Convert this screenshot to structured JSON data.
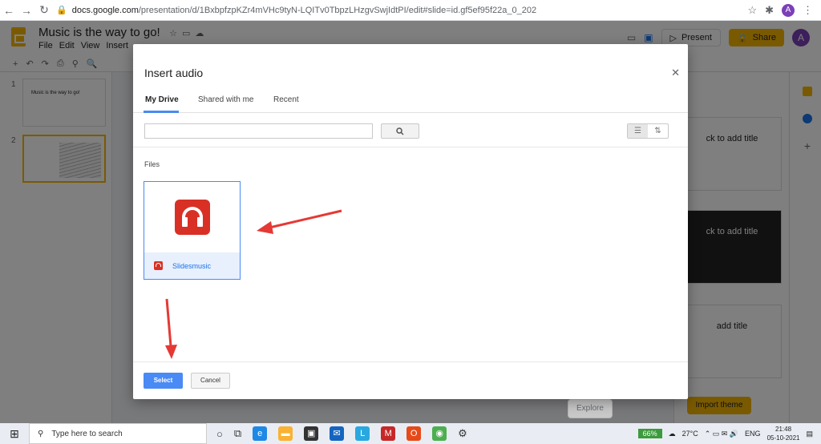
{
  "browser": {
    "url_host": "docs.google.com",
    "url_path": "/presentation/d/1BxbpfzpKZr4mVHc9tyN-LQITv0TbpzLHzgvSwjIdtPI/edit#slide=id.gf5ef95f22a_0_202",
    "profile_initial": "A"
  },
  "app": {
    "doc_title": "Music is the way to go!",
    "menus": [
      "File",
      "Edit",
      "View",
      "Insert"
    ],
    "present_label": "Present",
    "share_label": "Share",
    "avatar_initial": "A",
    "slides": [
      {
        "number": "1",
        "title": "Music is the way to go!"
      },
      {
        "number": "2",
        "title": ""
      }
    ],
    "layout_previews": [
      "ck to add title",
      "ck to add title",
      "add title"
    ],
    "import_theme_label": "Import theme",
    "explore_label": "Explore"
  },
  "dialog": {
    "title": "Insert audio",
    "tabs": [
      "My Drive",
      "Shared with me",
      "Recent"
    ],
    "files_label": "Files",
    "file_name": "Slidesmusic",
    "select_label": "Select",
    "cancel_label": "Cancel"
  },
  "taskbar": {
    "search_placeholder": "Type here to search",
    "battery": "66%",
    "weather": "27°C",
    "language": "ENG",
    "time": "21:48",
    "date": "05-10-2021"
  },
  "colors": {
    "accent_blue": "#4a8af4",
    "slides_yellow": "#f4b400",
    "app_red": "#d93025",
    "annotation_red": "#e53935"
  }
}
